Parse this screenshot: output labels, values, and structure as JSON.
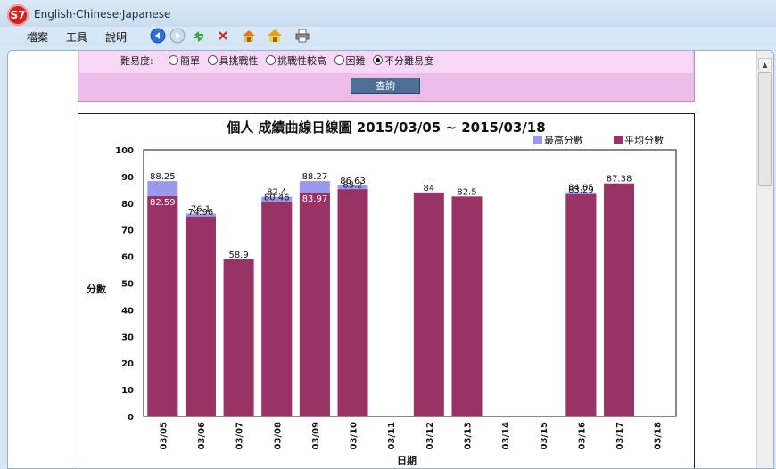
{
  "window": {
    "title": "English·Chinese·Japanese",
    "logo_text": "S7"
  },
  "menu": {
    "items": [
      "檔案",
      "工具",
      "說明"
    ]
  },
  "toolbar": {
    "icons": [
      "back-icon",
      "forward-icon",
      "refresh-icon",
      "stop-icon",
      "home-icon",
      "home-alt-icon",
      "print-icon"
    ]
  },
  "form": {
    "difficulty_label": "難易度:",
    "options": [
      {
        "label": "簡單",
        "checked": false
      },
      {
        "label": "具挑戰性",
        "checked": false
      },
      {
        "label": "挑戰性較高",
        "checked": false
      },
      {
        "label": "困難",
        "checked": false
      },
      {
        "label": "不分難易度",
        "checked": true
      }
    ],
    "query_button": "查詢"
  },
  "colors": {
    "max": "#9999ee",
    "avg": "#993366"
  },
  "chart_data": {
    "type": "bar",
    "title": "個人 成績曲線日線圖 2015/03/05 ~ 2015/03/18",
    "xlabel": "日期",
    "ylabel": "分數",
    "ylim": [
      0,
      100
    ],
    "yticks": [
      "0",
      "10",
      "20",
      "30",
      "40",
      "50",
      "60",
      "70",
      "80",
      "90",
      "100"
    ],
    "legend_position": "top-right",
    "categories": [
      "03/05",
      "03/06",
      "03/07",
      "03/08",
      "03/09",
      "03/10",
      "03/11",
      "03/12",
      "03/13",
      "03/14",
      "03/15",
      "03/16",
      "03/17",
      "03/18"
    ],
    "series": [
      {
        "name": "最高分數",
        "values": [
          88.25,
          76.1,
          null,
          82.4,
          88.27,
          86.63,
          null,
          null,
          null,
          null,
          null,
          84.05,
          null,
          null
        ],
        "labels": [
          "88.25",
          "76.1",
          "",
          "82.4",
          "88.27",
          "86.63",
          "",
          "",
          "",
          "",
          "",
          "84.05",
          "",
          ""
        ]
      },
      {
        "name": "平均分數",
        "values": [
          82.59,
          74.96,
          58.9,
          80.46,
          83.97,
          85.2,
          null,
          84,
          82.5,
          null,
          null,
          83.29,
          87.38,
          null
        ],
        "labels": [
          "82.59",
          "74.96",
          "58.9",
          "80.46",
          "83.97",
          "85.2",
          "",
          "84",
          "82.5",
          "",
          "",
          "83.29",
          "87.38",
          ""
        ]
      }
    ]
  }
}
